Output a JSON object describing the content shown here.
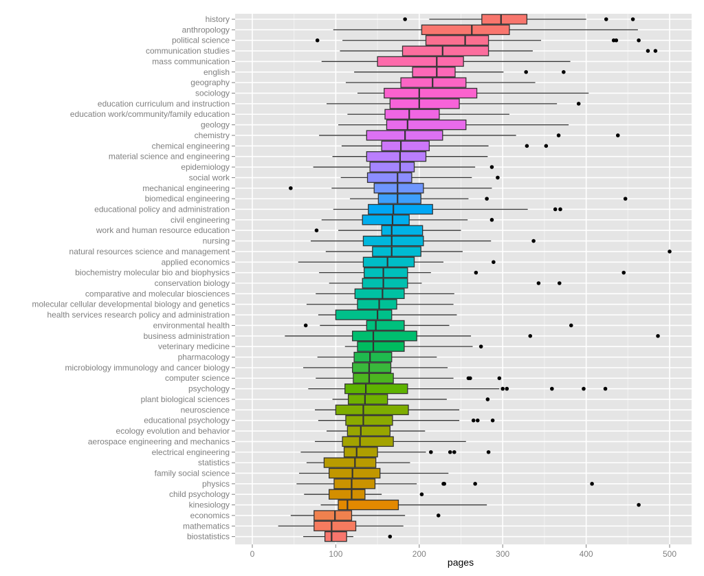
{
  "chart_data": {
    "type": "boxplot",
    "orientation": "horizontal",
    "title": "",
    "xlabel": "pages",
    "ylabel": "",
    "xlim": [
      -10,
      520
    ],
    "xticks": [
      0,
      100,
      200,
      300,
      400,
      500
    ],
    "grid": true,
    "legend": "none",
    "series": [
      {
        "name": "history",
        "color": "#F8766D",
        "whisker_low": 212,
        "q1": 275,
        "median": 298,
        "q3": 329,
        "whisker_high": 400,
        "outliers": [
          183,
          424,
          456
        ]
      },
      {
        "name": "anthropology",
        "color": "#F9766E",
        "whisker_low": 97,
        "q1": 203,
        "median": 263,
        "q3": 308,
        "whisker_high": 462,
        "outliers": []
      },
      {
        "name": "political science",
        "color": "#FB6F90",
        "whisker_low": 108,
        "q1": 208,
        "median": 255,
        "q3": 283,
        "whisker_high": 346,
        "outliers": [
          78,
          433,
          436,
          463
        ]
      },
      {
        "name": "communication studies",
        "color": "#FC6E9E",
        "whisker_low": 105,
        "q1": 180,
        "median": 228,
        "q3": 283,
        "whisker_high": 336,
        "outliers": [
          474,
          483
        ]
      },
      {
        "name": "mass communication",
        "color": "#FD6BAB",
        "whisker_low": 83,
        "q1": 150,
        "median": 221,
        "q3": 253,
        "whisker_high": 381,
        "outliers": []
      },
      {
        "name": "english",
        "color": "#FD68B8",
        "whisker_low": 122,
        "q1": 192,
        "median": 221,
        "q3": 243,
        "whisker_high": 301,
        "outliers": [
          328,
          373
        ]
      },
      {
        "name": "geography",
        "color": "#FC65C4",
        "whisker_low": 112,
        "q1": 178,
        "median": 216,
        "q3": 256,
        "whisker_high": 339,
        "outliers": []
      },
      {
        "name": "sociology",
        "color": "#FB62CE",
        "whisker_low": 126,
        "q1": 158,
        "median": 200,
        "q3": 269,
        "whisker_high": 403,
        "outliers": []
      },
      {
        "name": "education curriculum and instruction",
        "color": "#F763D9",
        "whisker_low": 89,
        "q1": 165,
        "median": 200,
        "q3": 248,
        "whisker_high": 365,
        "outliers": [
          391
        ]
      },
      {
        "name": "education work/community/family education",
        "color": "#F066E3",
        "whisker_low": 114,
        "q1": 159,
        "median": 188,
        "q3": 224,
        "whisker_high": 308,
        "outliers": []
      },
      {
        "name": "geology",
        "color": "#E86BEB",
        "whisker_low": 103,
        "q1": 161,
        "median": 186,
        "q3": 256,
        "whisker_high": 379,
        "outliers": []
      },
      {
        "name": "chemistry",
        "color": "#DC71F3",
        "whisker_low": 80,
        "q1": 137,
        "median": 183,
        "q3": 228,
        "whisker_high": 316,
        "outliers": [
          367,
          438
        ]
      },
      {
        "name": "chemical engineering",
        "color": "#CC77F9",
        "whisker_low": 107,
        "q1": 155,
        "median": 178,
        "q3": 212,
        "whisker_high": 283,
        "outliers": [
          329,
          352
        ]
      },
      {
        "name": "material science and engineering",
        "color": "#BA7EFD",
        "whisker_low": 96,
        "q1": 137,
        "median": 177,
        "q3": 208,
        "whisker_high": 282,
        "outliers": []
      },
      {
        "name": "epidemiology",
        "color": "#A585FF",
        "whisker_low": 73,
        "q1": 141,
        "median": 177,
        "q3": 194,
        "whisker_high": 267,
        "outliers": [
          287
        ]
      },
      {
        "name": "social work",
        "color": "#8C8DFF",
        "whisker_low": 106,
        "q1": 138,
        "median": 174,
        "q3": 191,
        "whisker_high": 263,
        "outliers": [
          294
        ]
      },
      {
        "name": "mechanical engineering",
        "color": "#6E96FE",
        "whisker_low": 95,
        "q1": 146,
        "median": 174,
        "q3": 205,
        "whisker_high": 287,
        "outliers": [
          46
        ]
      },
      {
        "name": "biomedical engineering",
        "color": "#3E9FFB",
        "whisker_low": 117,
        "q1": 151,
        "median": 174,
        "q3": 202,
        "whisker_high": 259,
        "outliers": [
          281,
          447
        ]
      },
      {
        "name": "educational policy and administration",
        "color": "#00A7F5",
        "whisker_low": 97,
        "q1": 139,
        "median": 169,
        "q3": 216,
        "whisker_high": 330,
        "outliers": [
          363,
          369
        ]
      },
      {
        "name": "civil engineering",
        "color": "#00AEEE",
        "whisker_low": 83,
        "q1": 132,
        "median": 168,
        "q3": 188,
        "whisker_high": 258,
        "outliers": [
          287
        ]
      },
      {
        "name": "work and human resource education",
        "color": "#00B3E6",
        "whisker_low": 103,
        "q1": 155,
        "median": 167,
        "q3": 204,
        "whisker_high": 250,
        "outliers": [
          77
        ]
      },
      {
        "name": "nursing",
        "color": "#00B7DC",
        "whisker_low": 70,
        "q1": 133,
        "median": 167,
        "q3": 205,
        "whisker_high": 286,
        "outliers": [
          337
        ]
      },
      {
        "name": "natural resources science and management",
        "color": "#00BBD2",
        "whisker_low": 88,
        "q1": 144,
        "median": 167,
        "q3": 202,
        "whisker_high": 252,
        "outliers": [
          500
        ]
      },
      {
        "name": "applied economics",
        "color": "#00BDC7",
        "whisker_low": 55,
        "q1": 133,
        "median": 162,
        "q3": 194,
        "whisker_high": 229,
        "outliers": [
          289
        ]
      },
      {
        "name": "biochemistry molecular bio and biophysics",
        "color": "#00BFBB",
        "whisker_low": 80,
        "q1": 134,
        "median": 157,
        "q3": 186,
        "whisker_high": 214,
        "outliers": [
          268,
          445
        ]
      },
      {
        "name": "conservation biology",
        "color": "#00C0AF",
        "whisker_low": 92,
        "q1": 132,
        "median": 157,
        "q3": 186,
        "whisker_high": 203,
        "outliers": [
          343,
          368
        ]
      },
      {
        "name": "comparative and molecular biosciences",
        "color": "#00C1A3",
        "whisker_low": 76,
        "q1": 123,
        "median": 156,
        "q3": 182,
        "whisker_high": 242,
        "outliers": []
      },
      {
        "name": "molecular cellular developmental biology and genetics",
        "color": "#00C196",
        "whisker_low": 65,
        "q1": 126,
        "median": 152,
        "q3": 173,
        "whisker_high": 241,
        "outliers": []
      },
      {
        "name": "health services research policy and administration",
        "color": "#00C08A",
        "whisker_low": 79,
        "q1": 100,
        "median": 150,
        "q3": 167,
        "whisker_high": 245,
        "outliers": []
      },
      {
        "name": "environmental health",
        "color": "#00C07D",
        "whisker_low": 81,
        "q1": 137,
        "median": 148,
        "q3": 182,
        "whisker_high": 236,
        "outliers": [
          64,
          382
        ]
      },
      {
        "name": "business administration",
        "color": "#00BE6F",
        "whisker_low": 39,
        "q1": 120,
        "median": 145,
        "q3": 197,
        "whisker_high": 262,
        "outliers": [
          333,
          486
        ]
      },
      {
        "name": "veterinary medicine",
        "color": "#00BC5F",
        "whisker_low": 111,
        "q1": 126,
        "median": 145,
        "q3": 182,
        "whisker_high": 264,
        "outliers": [
          274
        ]
      },
      {
        "name": "pharmacology",
        "color": "#1FBA4E",
        "whisker_low": 78,
        "q1": 122,
        "median": 141,
        "q3": 167,
        "whisker_high": 221,
        "outliers": []
      },
      {
        "name": "microbiology immunology and cancer biology",
        "color": "#39B83B",
        "whisker_low": 61,
        "q1": 120,
        "median": 140,
        "q3": 166,
        "whisker_high": 234,
        "outliers": []
      },
      {
        "name": "computer science",
        "color": "#4CB520",
        "whisker_low": 76,
        "q1": 121,
        "median": 140,
        "q3": 169,
        "whisker_high": 241,
        "outliers": [
          259,
          261,
          296
        ]
      },
      {
        "name": "psychology",
        "color": "#5EB300",
        "whisker_low": 67,
        "q1": 111,
        "median": 136,
        "q3": 186,
        "whisker_high": 296,
        "outliers": [
          300,
          305,
          359,
          397,
          423
        ]
      },
      {
        "name": "plant biological sciences",
        "color": "#6FB000",
        "whisker_low": 96,
        "q1": 115,
        "median": 135,
        "q3": 162,
        "whisker_high": 233,
        "outliers": [
          282
        ]
      },
      {
        "name": "neuroscience",
        "color": "#7EAD00",
        "whisker_low": 75,
        "q1": 100,
        "median": 133,
        "q3": 187,
        "whisker_high": 248,
        "outliers": []
      },
      {
        "name": "educational psychology",
        "color": "#8BAA00",
        "whisker_low": 79,
        "q1": 112,
        "median": 133,
        "q3": 168,
        "whisker_high": 248,
        "outliers": [
          265,
          270,
          288
        ]
      },
      {
        "name": "ecology evolution and behavior",
        "color": "#98A600",
        "whisker_low": 89,
        "q1": 114,
        "median": 130,
        "q3": 165,
        "whisker_high": 207,
        "outliers": []
      },
      {
        "name": "aerospace engineering and mechanics",
        "color": "#A3A300",
        "whisker_low": 75,
        "q1": 108,
        "median": 129,
        "q3": 169,
        "whisker_high": 256,
        "outliers": []
      },
      {
        "name": "electrical engineering",
        "color": "#AE9F00",
        "whisker_low": 58,
        "q1": 110,
        "median": 125,
        "q3": 150,
        "whisker_high": 208,
        "outliers": [
          214,
          237,
          242,
          283
        ]
      },
      {
        "name": "statistics",
        "color": "#B89B00",
        "whisker_low": 65,
        "q1": 86,
        "median": 123,
        "q3": 148,
        "whisker_high": 189,
        "outliers": []
      },
      {
        "name": "family social science",
        "color": "#C19700",
        "whisker_low": 56,
        "q1": 92,
        "median": 120,
        "q3": 153,
        "whisker_high": 235,
        "outliers": []
      },
      {
        "name": "physics",
        "color": "#CA9300",
        "whisker_low": 53,
        "q1": 98,
        "median": 119,
        "q3": 147,
        "whisker_high": 197,
        "outliers": [
          229,
          230,
          267,
          407
        ]
      },
      {
        "name": "child psychology",
        "color": "#D38F00",
        "whisker_low": 62,
        "q1": 92,
        "median": 119,
        "q3": 135,
        "whisker_high": 155,
        "outliers": [
          203
        ]
      },
      {
        "name": "kinesiology",
        "color": "#E38900",
        "whisker_low": 82,
        "q1": 103,
        "median": 114,
        "q3": 175,
        "whisker_high": 281,
        "outliers": [
          463
        ]
      },
      {
        "name": "economics",
        "color": "#F0814E",
        "whisker_low": 46,
        "q1": 74,
        "median": 99,
        "q3": 119,
        "whisker_high": 183,
        "outliers": [
          223
        ]
      },
      {
        "name": "mathematics",
        "color": "#F67B5F",
        "whisker_low": 31,
        "q1": 74,
        "median": 95,
        "q3": 124,
        "whisker_high": 181,
        "outliers": []
      },
      {
        "name": "biostatistics",
        "color": "#F8766D",
        "whisker_low": 61,
        "q1": 87,
        "median": 95,
        "q3": 113,
        "whisker_high": 121,
        "outliers": [
          165
        ]
      }
    ]
  }
}
